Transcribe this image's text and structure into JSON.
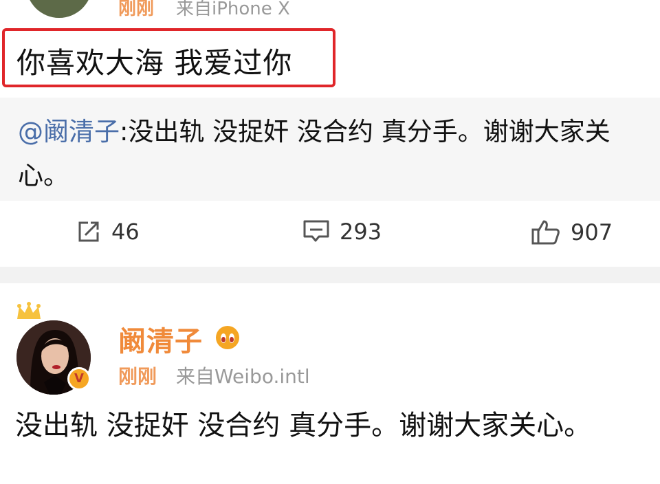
{
  "post1": {
    "time": "刚刚",
    "source": "来自iPhone X",
    "headline": "你喜欢大海 我爱过你",
    "repost": {
      "mention": "@阚清子",
      "text": ":没出轨 没捉奸 没合约 真分手。谢谢大家关心。"
    },
    "actions": {
      "repost_count": "46",
      "comment_count": "293",
      "like_count": "907"
    }
  },
  "post2": {
    "username": "阚清子",
    "time": "刚刚",
    "source": "来自Weibo.intl",
    "body": "没出轨 没捉奸 没合约 真分手。谢谢大家关心。"
  },
  "colors": {
    "highlight_border": "#e0262a",
    "mention": "#4a6ea9",
    "username": "#f08a3a",
    "time": "#f09a5a"
  },
  "icons": [
    "repost-icon",
    "comment-icon",
    "like-icon",
    "crown-icon",
    "member-icon",
    "verified-badge-icon"
  ]
}
